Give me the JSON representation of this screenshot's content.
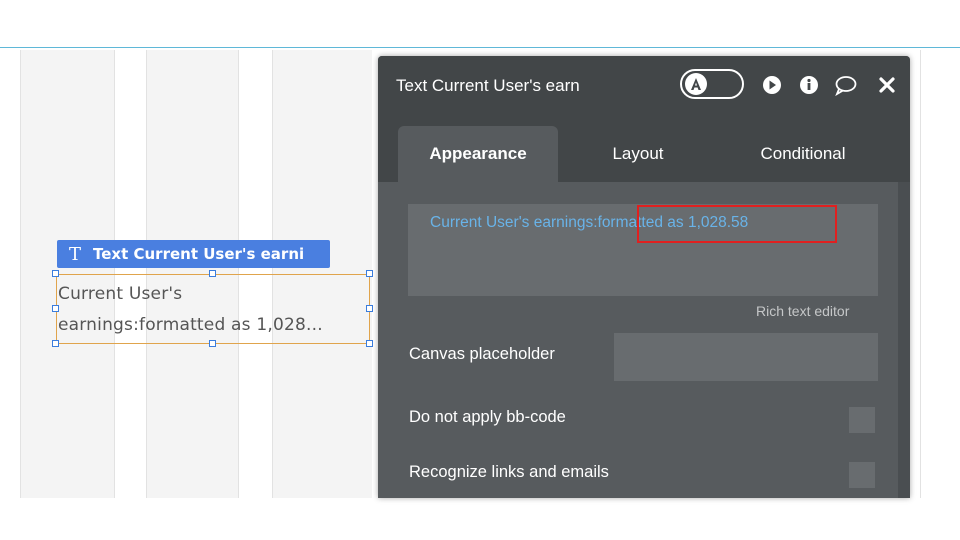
{
  "canvas": {
    "element_tag": "Text Current User's earni",
    "element_tag_icon": "text-icon",
    "element_text_line1": "Current User's",
    "element_text_line2": "earnings:formatted as 1,028..."
  },
  "panel": {
    "title": "Text Current User's earn",
    "toggle_icon": "avatar-icon",
    "header_icons": [
      "play-icon",
      "info-icon",
      "comment-icon",
      "close-icon"
    ],
    "tabs": [
      {
        "label": "Appearance",
        "active": true
      },
      {
        "label": "Layout",
        "active": false
      },
      {
        "label": "Conditional",
        "active": false
      }
    ],
    "rich_text": {
      "prefix": "Current User's earnings",
      "highlighted": ":formatted as 1,028.58",
      "hint": "Rich text editor"
    },
    "properties": {
      "canvas_placeholder_label": "Canvas placeholder",
      "canvas_placeholder_value": "",
      "bb_code_label": "Do not apply bb-code",
      "links_label": "Recognize links and emails"
    }
  },
  "colors": {
    "panel_header": "#424648",
    "panel_body": "#575b5e",
    "dynamic_text": "#69b3e8",
    "highlight_box": "#e02020",
    "element_tag": "#4a7fe0",
    "selection_border": "#e0a44c"
  }
}
